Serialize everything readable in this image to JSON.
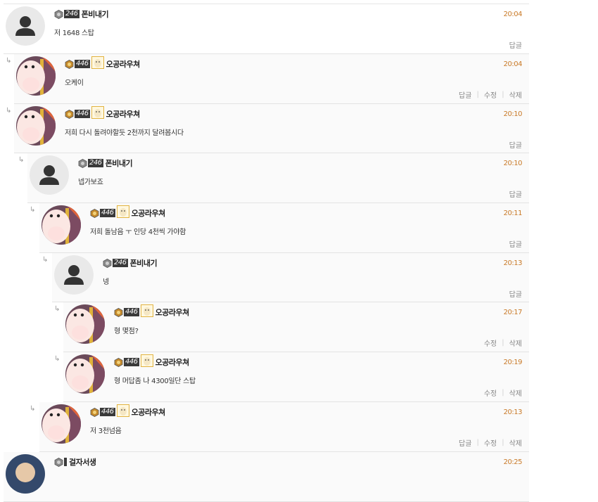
{
  "comments": [
    {
      "nick": "폰비내기",
      "level": "246",
      "time": "20:04",
      "text": "저 1648 스탑",
      "actions": [
        "답글"
      ]
    },
    {
      "nick": "오공라우쳐",
      "level": "446",
      "time": "20:04",
      "text": "오케이",
      "actions": [
        "답글",
        "수정",
        "삭제"
      ]
    },
    {
      "nick": "오공라우쳐",
      "level": "446",
      "time": "20:10",
      "text": "저희 다시 돌려야할듯 2천까지 달려봅시다",
      "actions": [
        "답글"
      ]
    },
    {
      "nick": "폰비내기",
      "level": "246",
      "time": "20:10",
      "text": "넵가보죠",
      "actions": [
        "답글"
      ]
    },
    {
      "nick": "오공라우쳐",
      "level": "446",
      "time": "20:11",
      "text": "저희 돌남음 ㅜ 인당 4천씩 가야함",
      "actions": [
        "답글"
      ]
    },
    {
      "nick": "폰비내기",
      "level": "246",
      "time": "20:13",
      "text": "넹",
      "actions": [
        "답글"
      ]
    },
    {
      "nick": "오공라우쳐",
      "level": "446",
      "time": "20:17",
      "text": "형 몇점?",
      "actions": [
        "수정",
        "삭제"
      ]
    },
    {
      "nick": "오공라우쳐",
      "level": "446",
      "time": "20:19",
      "text": "형 머답좀 나 4300일단 스탑",
      "actions": [
        "수정",
        "삭제"
      ]
    },
    {
      "nick": "오공라우쳐",
      "level": "446",
      "time": "20:13",
      "text": "저 3천넘음",
      "actions": [
        "답글",
        "수정",
        "삭제"
      ]
    },
    {
      "nick": "걸자서생",
      "level": "",
      "time": "20:25",
      "text": "",
      "actions": []
    }
  ],
  "icons": {
    "reply_arrow": "reply-arrow-icon",
    "default_avatar": "user-silhouette-icon",
    "character_avatar": "character-avatar-icon"
  },
  "colors": {
    "time": "#c97a28",
    "rank_bg": "#3a3a3a",
    "border": "#e3e3e3"
  }
}
